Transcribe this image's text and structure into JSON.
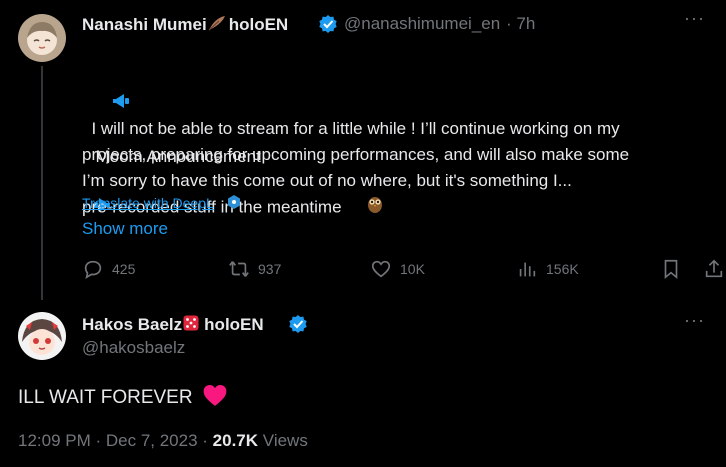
{
  "tweet": {
    "author_name": "Nanashi Mumei",
    "author_suffix": "holoEN",
    "handle": "@nanashimumei_en",
    "time": "· 7h",
    "title": "Moom Announcement",
    "body": "I will not be able to stream for a little while ! I’ll continue working on my\nprojects, preparing for upcoming performances, and will also make some\npre-recorded stuff in the meantime",
    "body2": "I’m sorry to have this come out of no where, but it's something I...",
    "translate_label": "Translate with DeepL",
    "show_more_label": "Show more",
    "actions": {
      "replies": "425",
      "reposts": "937",
      "likes": "10K",
      "views": "156K"
    }
  },
  "reply": {
    "author_name": "Hakos Baelz",
    "author_suffix": "holoEN",
    "handle": "@hakosbaelz",
    "text": "ILL WAIT FOREVER",
    "time": "12:09 PM · Dec 7, 2023 ·",
    "views_count": "20.7K",
    "views_label": "Views"
  },
  "icons": {
    "verified_color": "#1d9bf0",
    "accent": "#1d9bf0"
  }
}
